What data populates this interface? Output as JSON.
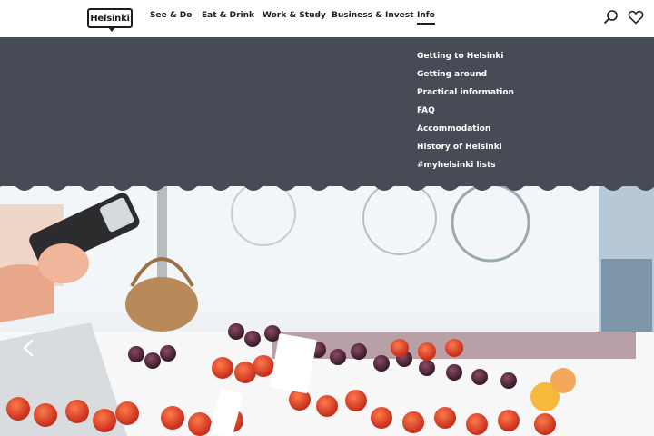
{
  "header": {
    "logo_text": "Helsinki",
    "nav": [
      {
        "label": "See & Do"
      },
      {
        "label": "Eat & Drink"
      },
      {
        "label": "Work & Study"
      },
      {
        "label": "Business & Invest"
      },
      {
        "label": "Info"
      }
    ],
    "active_nav": "Info",
    "icons": {
      "search": "search-icon",
      "favorites": "heart-icon"
    }
  },
  "dropdown": {
    "background": "#464b55",
    "items": [
      {
        "label": "Getting to Helsinki"
      },
      {
        "label": "Getting around"
      },
      {
        "label": "Practical information"
      },
      {
        "label": "FAQ"
      },
      {
        "label": "Accommodation"
      },
      {
        "label": "History of Helsinki"
      },
      {
        "label": "#myhelsinki lists"
      }
    ]
  },
  "hero": {
    "prev_icon": "chevron-left-icon"
  }
}
